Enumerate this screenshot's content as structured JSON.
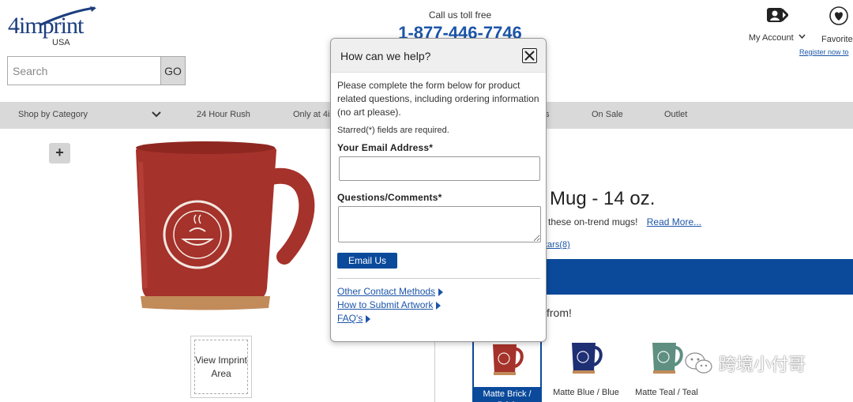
{
  "header": {
    "logo_text": "4imprint",
    "logo_country": "USA",
    "search_placeholder": "Search",
    "go_label": "GO",
    "phone_label": "Call us toll free",
    "phone_number": "1-877-446-7746",
    "account_label": "My Account",
    "favorites_label": "Favorite",
    "register_link": "Register now to"
  },
  "nav": {
    "items": [
      "Shop by Category",
      "24 Hour Rush",
      "Only at 4i",
      "s",
      "On Sale",
      "Outlet"
    ]
  },
  "product": {
    "title_visible": "e Mug - 14 oz.",
    "desc_visible": "these on-trend mugs!",
    "read_more": "Read More...",
    "stars_visible": "tars(8)",
    "choose_visible": "from!",
    "view_imprint": "View Imprint Area",
    "swatches": [
      {
        "label": "Matte Brick / Brick",
        "color": "#a5322b",
        "selected": true
      },
      {
        "label": "Matte Blue / Blue",
        "color": "#1f2f73",
        "selected": false
      },
      {
        "label": "Matte Teal / Teal",
        "color": "#5e8f80",
        "selected": false
      }
    ]
  },
  "modal": {
    "title": "How can we help?",
    "intro": "Please complete the form below for product related questions, including ordering information (no art please).",
    "required_note": "Starred(*) fields are required.",
    "email_label": "Your Email Address*",
    "comments_label": "Questions/Comments*",
    "email_button": "Email Us",
    "links": [
      "Other Contact Methods",
      "How to Submit Artwork",
      "FAQ's"
    ]
  },
  "watermark": {
    "text": "跨境小付哥"
  },
  "colors": {
    "brand_blue": "#0b4a9b",
    "link_blue": "#1c55a8",
    "nav_gray": "#d9d9d9",
    "mug_red": "#a5322b"
  }
}
